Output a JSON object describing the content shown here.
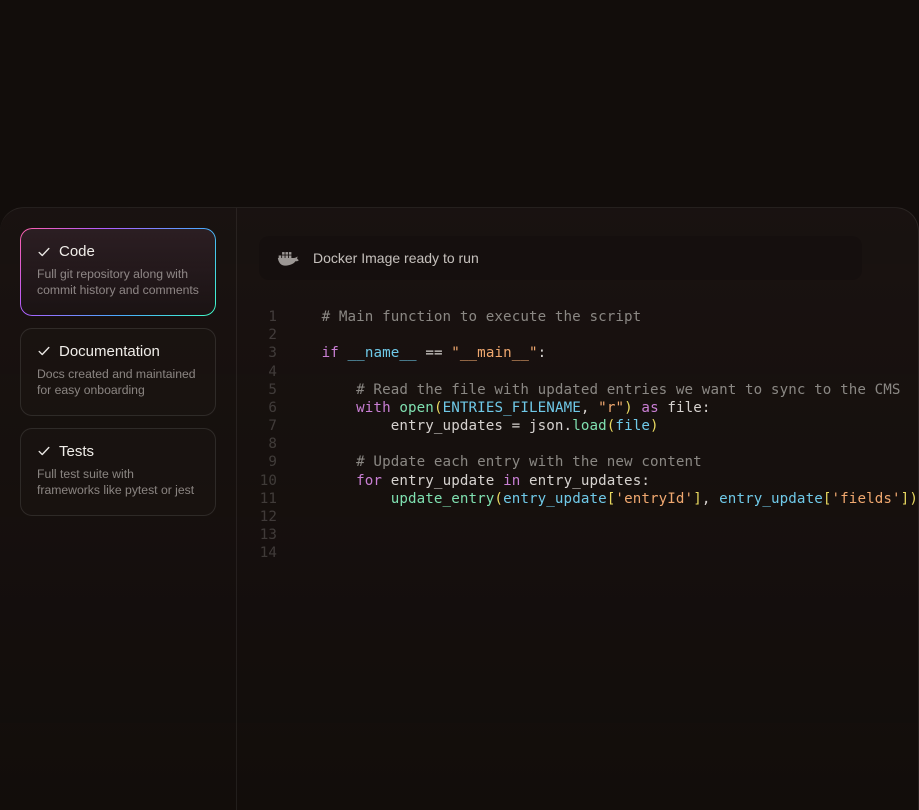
{
  "sidebar": {
    "items": [
      {
        "title": "Code",
        "desc": "Full git repository along with commit history and comments",
        "active": true
      },
      {
        "title": "Documentation",
        "desc": "Docs created and maintained for easy onboarding",
        "active": false
      },
      {
        "title": "Tests",
        "desc": "Full test suite with frameworks like pytest or jest",
        "active": false
      }
    ]
  },
  "docker": {
    "label": "Docker Image ready to run"
  },
  "code": {
    "lines": [
      {
        "n": 1,
        "tokens": [
          [
            "    ",
            ""
          ],
          [
            "# Main function to execute the script",
            "comment"
          ]
        ]
      },
      {
        "n": 2,
        "tokens": []
      },
      {
        "n": 3,
        "tokens": [
          [
            "    ",
            ""
          ],
          [
            "if",
            "kw"
          ],
          [
            " ",
            ""
          ],
          [
            "__name__",
            "var"
          ],
          [
            " == ",
            "op"
          ],
          [
            "\"__main__\"",
            "str"
          ],
          [
            ":",
            ""
          ]
        ]
      },
      {
        "n": 4,
        "tokens": []
      },
      {
        "n": 5,
        "tokens": [
          [
            "        ",
            ""
          ],
          [
            "# Read the file with updated entries we want to sync to the CMS",
            "comment"
          ]
        ]
      },
      {
        "n": 6,
        "tokens": [
          [
            "        ",
            ""
          ],
          [
            "with",
            "kw"
          ],
          [
            " ",
            ""
          ],
          [
            "open",
            "fn"
          ],
          [
            "(",
            "brace"
          ],
          [
            "ENTRIES_FILENAME",
            "const"
          ],
          [
            ", ",
            ""
          ],
          [
            "\"r\"",
            "str"
          ],
          [
            ")",
            "brace"
          ],
          [
            " ",
            ""
          ],
          [
            "as",
            "kw"
          ],
          [
            " file:",
            ""
          ]
        ]
      },
      {
        "n": 7,
        "tokens": [
          [
            "            entry_updates = json.",
            ""
          ],
          [
            "load",
            "fn"
          ],
          [
            "(",
            "brace"
          ],
          [
            "file",
            "var"
          ],
          [
            ")",
            "brace"
          ]
        ]
      },
      {
        "n": 8,
        "tokens": []
      },
      {
        "n": 9,
        "tokens": [
          [
            "        ",
            ""
          ],
          [
            "# Update each entry with the new content",
            "comment"
          ]
        ]
      },
      {
        "n": 10,
        "tokens": [
          [
            "        ",
            ""
          ],
          [
            "for",
            "kw"
          ],
          [
            " entry_update ",
            ""
          ],
          [
            "in",
            "kw"
          ],
          [
            " entry_updates:",
            ""
          ]
        ]
      },
      {
        "n": 11,
        "tokens": [
          [
            "            ",
            ""
          ],
          [
            "update_entry",
            "fn"
          ],
          [
            "(",
            "brace"
          ],
          [
            "entry_update",
            "var"
          ],
          [
            "[",
            "brace"
          ],
          [
            "'entryId'",
            "str"
          ],
          [
            "]",
            "brace"
          ],
          [
            ", ",
            ""
          ],
          [
            "entry_update",
            "var"
          ],
          [
            "[",
            "brace"
          ],
          [
            "'fields'",
            "str"
          ],
          [
            "]",
            "brace"
          ],
          [
            ")",
            "brace"
          ]
        ]
      },
      {
        "n": 12,
        "tokens": []
      },
      {
        "n": 13,
        "tokens": []
      },
      {
        "n": 14,
        "tokens": []
      }
    ]
  }
}
